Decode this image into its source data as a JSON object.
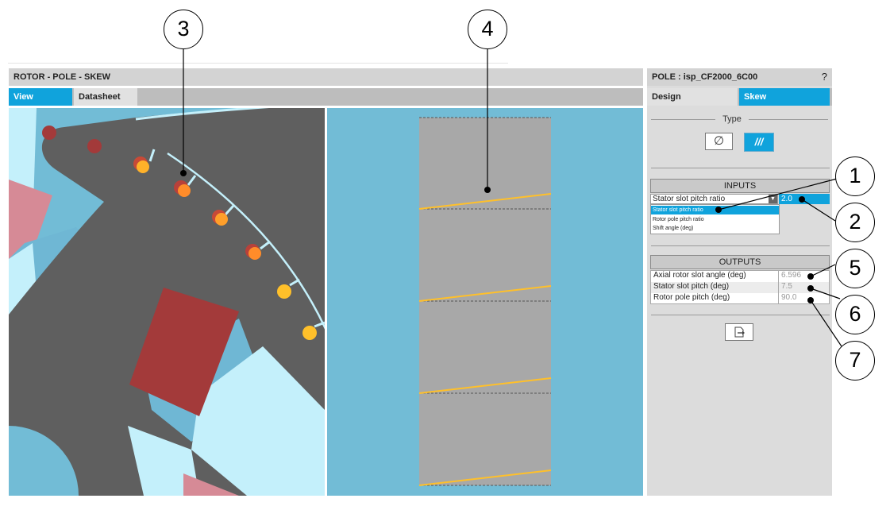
{
  "left_panel": {
    "title": "ROTOR - POLE - SKEW",
    "tabs": [
      {
        "label": "View",
        "active": true
      },
      {
        "label": "Datasheet",
        "active": false
      }
    ]
  },
  "right_panel": {
    "title": "POLE : isp_CF2000_6C00",
    "help": "?",
    "tabs": [
      {
        "label": "Design",
        "active": false
      },
      {
        "label": "Skew",
        "active": true
      }
    ],
    "type_label": "Type",
    "type_buttons": [
      {
        "label": "∅",
        "icon": "no-skew-icon"
      },
      {
        "label": "///",
        "icon": "skew-lines-icon"
      }
    ],
    "inputs": {
      "header": "INPUTS",
      "selected": "Stator slot pitch ratio",
      "value": "2.0",
      "options": [
        "Stator slot pitch ratio",
        "Rotor pole pitch ratio",
        "Shift angle (deg)"
      ]
    },
    "outputs": {
      "header": "OUTPUTS",
      "rows": [
        {
          "label": "Axial rotor slot angle (deg)",
          "value": "6.596"
        },
        {
          "label": "Stator slot pitch (deg)",
          "value": "7.5"
        },
        {
          "label": "Rotor pole pitch (deg)",
          "value": "90.0"
        }
      ]
    },
    "export_icon": "export-icon"
  },
  "callouts": [
    "1",
    "2",
    "3",
    "4",
    "5",
    "6",
    "7"
  ],
  "colors": {
    "accent": "#10a3dc",
    "view_bg": "#72bcd6",
    "rotor": "#5f5f5f",
    "magnet": "#a33a3a",
    "bar": "#ffc02a"
  }
}
